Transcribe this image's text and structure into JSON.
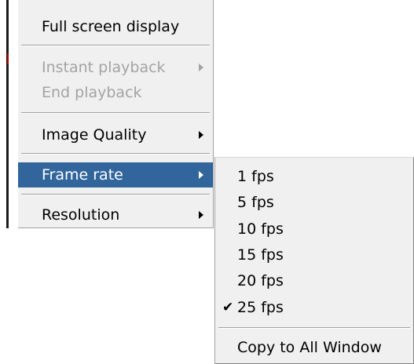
{
  "main_menu": {
    "items": [
      {
        "label": "Full screen display",
        "state": "enabled",
        "has_submenu": false
      },
      {
        "label": "Instant playback",
        "state": "disabled",
        "has_submenu": true
      },
      {
        "label": "End playback",
        "state": "disabled",
        "has_submenu": false
      },
      {
        "label": "Image Quality",
        "state": "enabled",
        "has_submenu": true
      },
      {
        "label": "Frame rate",
        "state": "highlighted",
        "has_submenu": true
      },
      {
        "label": "Resolution",
        "state": "enabled",
        "has_submenu": true
      }
    ]
  },
  "frame_rate_submenu": {
    "items": [
      {
        "label": "1 fps",
        "checked": false
      },
      {
        "label": "5 fps",
        "checked": false
      },
      {
        "label": "10 fps",
        "checked": false
      },
      {
        "label": "15 fps",
        "checked": false
      },
      {
        "label": "20 fps",
        "checked": false
      },
      {
        "label": "25 fps",
        "checked": true
      }
    ],
    "copy_label": "Copy to All Window",
    "check_glyph": "✔"
  },
  "colors": {
    "menu_background": "#f0f0f0",
    "highlight": "#31659c",
    "disabled_text": "#a3a3a3"
  }
}
